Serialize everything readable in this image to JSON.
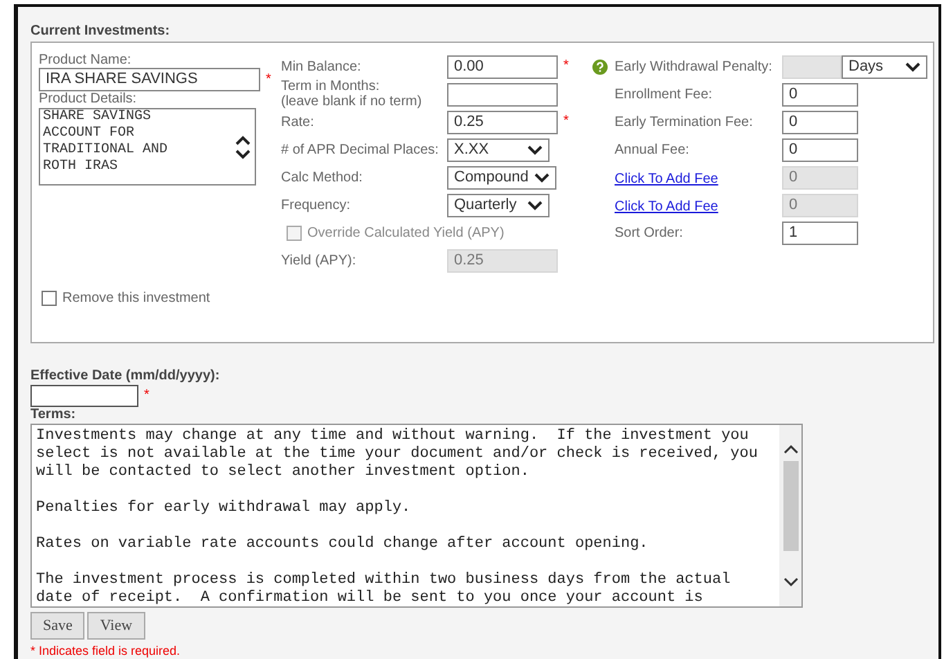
{
  "section_title": "Current Investments:",
  "product": {
    "name_label": "Product Name:",
    "name": "IRA SHARE SAVINGS",
    "name_required": true,
    "details_label": "Product Details:",
    "details": "SHARE SAVINGS ACCOUNT FOR TRADITIONAL AND ROTH IRAS"
  },
  "middle_fields": [
    {
      "kind": "input",
      "label": "Min Balance:",
      "value": "0.00",
      "required": true,
      "disabled": false
    },
    {
      "kind": "input",
      "label": "Term in Months:",
      "hint": "(leave blank if no term)",
      "required": false,
      "disabled": false
    },
    {
      "kind": "input",
      "label": "Rate:",
      "value": "0.25",
      "required": true,
      "disabled": false
    },
    {
      "kind": "select",
      "label": "# of APR Decimal Places:",
      "value": "X.XX"
    },
    {
      "kind": "select",
      "label": "Calc Method:",
      "value": "Compound"
    },
    {
      "kind": "select",
      "label": "Frequency:",
      "value": "Quarterly"
    },
    {
      "kind": "checkbox",
      "label": "Override Calculated Yield (APY)",
      "checked": false,
      "disabled": true
    },
    {
      "kind": "input",
      "label": "Yield (APY):",
      "value": "0.25",
      "required": false,
      "disabled": true
    }
  ],
  "right_fields": [
    {
      "kind": "penalty",
      "label": "Early Withdrawal Penalty:",
      "unit": "Days",
      "disabled": true
    },
    {
      "kind": "input",
      "label": "Enrollment Fee:",
      "value": "0",
      "disabled": false
    },
    {
      "kind": "input",
      "label": "Early Termination Fee:",
      "value": "0",
      "disabled": false
    },
    {
      "kind": "input",
      "label": "Annual Fee:",
      "value": "0",
      "disabled": false
    },
    {
      "kind": "link",
      "label": "Click To Add Fee",
      "value": "0",
      "disabled": true
    },
    {
      "kind": "link",
      "label": "Click To Add Fee",
      "value": "0",
      "disabled": true
    },
    {
      "kind": "input",
      "label": "Sort Order:",
      "value": "1",
      "disabled": false
    }
  ],
  "remove": {
    "label": "Remove this investment",
    "checked": false
  },
  "effective_date": {
    "label": "Effective Date (mm/dd/yyyy):",
    "required": true
  },
  "terms": {
    "label": "Terms:",
    "paragraphs": [
      "Investments may change at any time and without warning.  If the investment you select is not available at the time your document and/or check is received, you will be contacted to select another investment option.",
      "Penalties for early withdrawal may apply.",
      "Rates on variable rate accounts could change after account opening.",
      "The investment process is completed within two business days from the actual date of receipt.  A confirmation will be sent to you once your account is"
    ]
  },
  "buttons": [
    "Save",
    "View"
  ],
  "required_mark": "*",
  "required_note": "* Indicates field is required."
}
